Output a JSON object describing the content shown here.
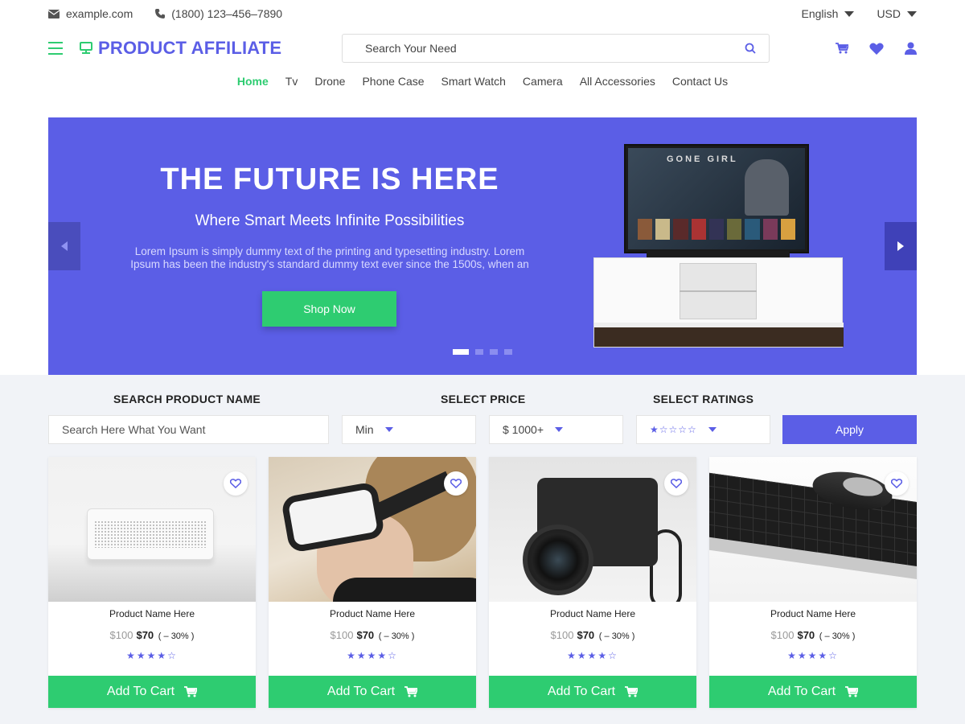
{
  "topbar": {
    "email": "example.com",
    "phone": "(1800) 123–456–7890",
    "language": "English",
    "currency": "USD"
  },
  "header": {
    "logo_text": "PRODUCT AFFILIATE",
    "search_placeholder": "Search Your Need"
  },
  "nav": [
    {
      "label": "Home",
      "active": true
    },
    {
      "label": "Tv"
    },
    {
      "label": "Drone"
    },
    {
      "label": "Phone Case"
    },
    {
      "label": "Smart Watch"
    },
    {
      "label": "Camera"
    },
    {
      "label": "All Accessories"
    },
    {
      "label": "Contact Us"
    }
  ],
  "hero": {
    "title": "THE FUTURE IS HERE",
    "subtitle": "Where Smart Meets Infinite Possibilities",
    "description": "Lorem Ipsum is simply dummy text of the printing and typesetting industry. Lorem Ipsum has been the industry's standard dummy text ever since the 1500s, when an",
    "button": "Shop Now",
    "tv_title": "GONE GIRL",
    "slides": 4,
    "active_slide": 1
  },
  "filters": {
    "product_name_label": "SEARCH PRODUCT NAME",
    "product_name_placeholder": "Search Here What You Want",
    "price_label": "SELECT PRICE",
    "price_min": "Min",
    "price_max": "$ 1000+",
    "ratings_label": "SELECT RATINGS",
    "ratings_value": 1,
    "apply": "Apply"
  },
  "products": [
    {
      "name": "Product Name Here",
      "old_price": "$100",
      "price": "$70",
      "discount": "( – 30% )",
      "rating": 4,
      "cart": "Add To Cart",
      "image": "speaker"
    },
    {
      "name": "Product Name Here",
      "old_price": "$100",
      "price": "$70",
      "discount": "( – 30% )",
      "rating": 4,
      "cart": "Add To Cart",
      "image": "vr-headset"
    },
    {
      "name": "Product Name Here",
      "old_price": "$100",
      "price": "$70",
      "discount": "( – 30% )",
      "rating": 4,
      "cart": "Add To Cart",
      "image": "camera"
    },
    {
      "name": "Product Name Here",
      "old_price": "$100",
      "price": "$70",
      "discount": "( – 30% )",
      "rating": 4,
      "cart": "Add To Cart",
      "image": "keyboard-mouse"
    }
  ],
  "colors": {
    "primary": "#5b5ee6",
    "accent": "#2ecc71"
  }
}
